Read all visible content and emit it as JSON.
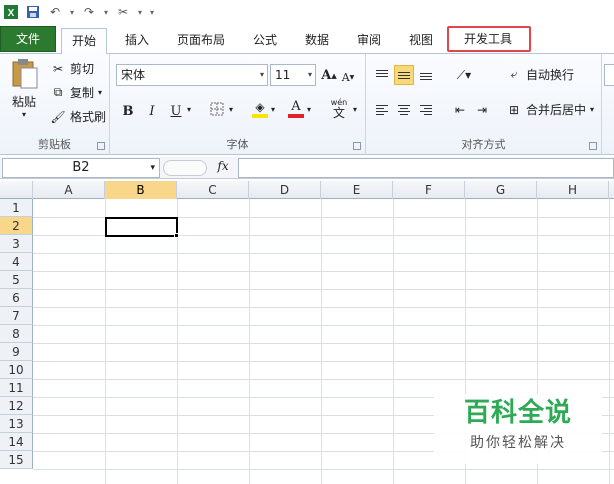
{
  "quick_access": {
    "icons": [
      "excel-logo-icon",
      "save-icon",
      "undo-icon",
      "redo-icon",
      "tools-icon",
      "customize-icon"
    ]
  },
  "tabs": [
    {
      "label": "文件"
    },
    {
      "label": "开始"
    },
    {
      "label": "插入"
    },
    {
      "label": "页面布局"
    },
    {
      "label": "公式"
    },
    {
      "label": "数据"
    },
    {
      "label": "审阅"
    },
    {
      "label": "视图"
    },
    {
      "label": "开发工具"
    }
  ],
  "ribbon": {
    "clipboard": {
      "paste_label": "粘贴",
      "cut_label": "剪切",
      "copy_label": "复制",
      "format_painter_label": "格式刷",
      "group_label": "剪贴板"
    },
    "font": {
      "font_name": "宋体",
      "font_size": "11",
      "bold": "B",
      "italic": "I",
      "underline": "U",
      "font_color_letter": "A",
      "phonetic_label": "wén",
      "phonetic_char": "文",
      "grow_font": "A",
      "shrink_font": "A",
      "group_label": "字体"
    },
    "alignment": {
      "wrap_text_label": "自动换行",
      "merge_center_label": "合并后居中",
      "group_label": "对齐方式"
    }
  },
  "formula_bar": {
    "name_box": "B2",
    "fx_label": "fx",
    "formula": ""
  },
  "sheet": {
    "columns": [
      "A",
      "B",
      "C",
      "D",
      "E",
      "F",
      "G",
      "H"
    ],
    "rows": [
      "1",
      "2",
      "3",
      "4",
      "5",
      "6",
      "7",
      "8",
      "9",
      "10",
      "11",
      "12",
      "13",
      "14",
      "15"
    ],
    "selected_column": "B",
    "selected_row": "2"
  },
  "watermark": {
    "title": "百科全说",
    "subtitle": "助你轻松解决"
  },
  "colors": {
    "file_tab": "#2b7a2f",
    "highlight_box": "#e0474c",
    "selection": "#f9d78a",
    "watermark_green": "#2eaa55"
  }
}
